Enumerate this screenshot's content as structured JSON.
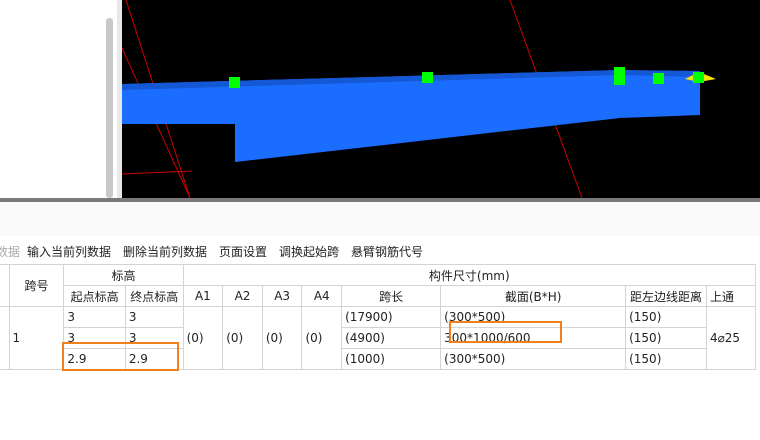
{
  "toolbar": {
    "items": [
      {
        "label": "数据",
        "enabled": false
      },
      {
        "label": "输入当前列数据",
        "enabled": true
      },
      {
        "label": "删除当前列数据",
        "enabled": true
      },
      {
        "label": "页面设置",
        "enabled": true
      },
      {
        "label": "调换起始跨",
        "enabled": true
      },
      {
        "label": "悬臂钢筋代号",
        "enabled": true
      }
    ]
  },
  "table": {
    "headers": {
      "span_no": "跨号",
      "elevation": "标高",
      "start_elev": "起点标高",
      "end_elev": "终点标高",
      "a1": "A1",
      "a2": "A2",
      "a3": "A3",
      "a4": "A4",
      "dimensions": "构件尺寸(mm)",
      "span_len": "跨长",
      "section": "截面(B*H)",
      "edge_dist": "距左边线距离",
      "top_rebar": "上通"
    },
    "span_no": "1",
    "a_values": [
      "(0)",
      "(0)",
      "(0)",
      "(0)"
    ],
    "top_rebar_value": "4⌀25",
    "rows": [
      {
        "start_elev": "3",
        "end_elev": "3",
        "span_len": "(17900)",
        "section": "(300*500)",
        "edge_dist": "(150)"
      },
      {
        "start_elev": "3",
        "end_elev": "3",
        "span_len": "(4900)",
        "section": "300*1000/600",
        "edge_dist": "(150)"
      },
      {
        "start_elev": "2.9",
        "end_elev": "2.9",
        "span_len": "(1000)",
        "section": "(300*500)",
        "edge_dist": "(150)"
      }
    ]
  },
  "colors": {
    "beam": "#1a6dff",
    "grip": "#00ff00",
    "highlight": "#f07f1e",
    "axis_line": "#cc0000",
    "viewport_bg": "#000000"
  }
}
